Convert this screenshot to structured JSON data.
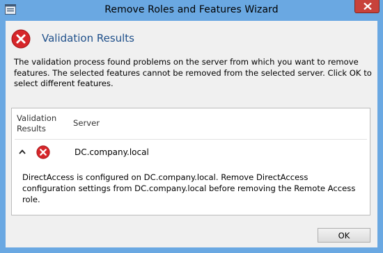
{
  "window": {
    "title": "Remove Roles and Features Wizard"
  },
  "header": {
    "heading": "Validation Results",
    "icon": "error-icon"
  },
  "message": "The validation process found problems on the server from which you want to remove features. The selected features cannot be removed from the selected server.  Click OK to select different features.",
  "results": {
    "columns": [
      "Validation Results",
      "Server"
    ],
    "rows": [
      {
        "status_icon": "error-icon",
        "expanded": true,
        "server": "DC.company.local",
        "detail": "DirectAccess is configured on DC.company.local. Remove DirectAccess configuration settings from DC.company.local before removing the Remote Access role."
      }
    ]
  },
  "buttons": {
    "ok_label": "OK"
  },
  "colors": {
    "title_bar": "#6aa8e2",
    "close_button": "#c8423b",
    "heading_text": "#1e4f8a",
    "error_red": "#d6262a"
  }
}
